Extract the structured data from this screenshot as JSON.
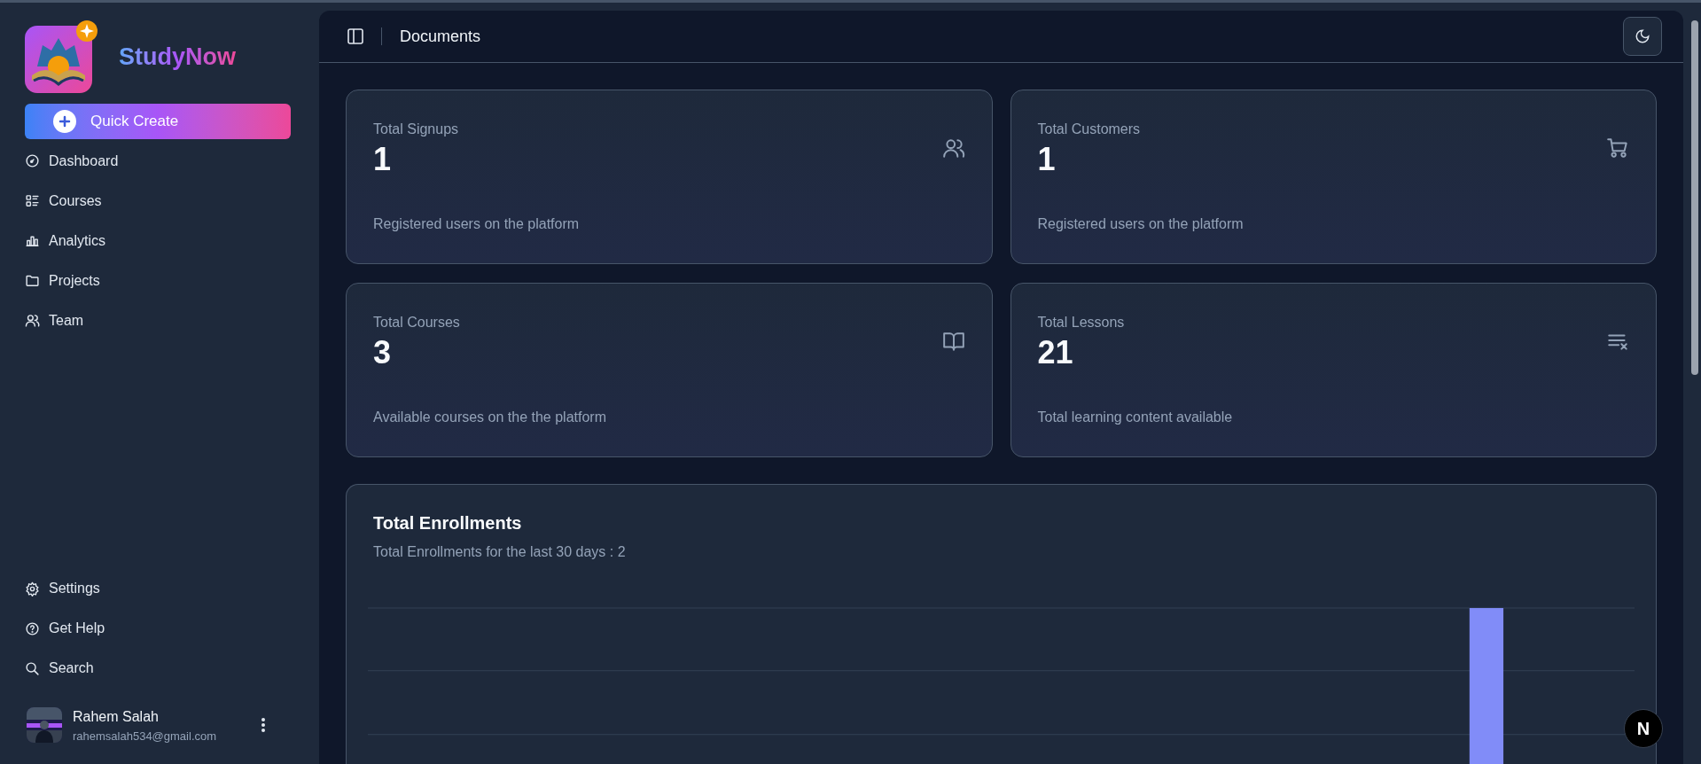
{
  "sidebar": {
    "brand": "StudyNow",
    "quick_create": "Quick Create",
    "nav_items": [
      {
        "label": "Dashboard"
      },
      {
        "label": "Courses"
      },
      {
        "label": "Analytics"
      },
      {
        "label": "Projects"
      },
      {
        "label": "Team"
      }
    ],
    "secondary_items": [
      {
        "label": "Settings"
      },
      {
        "label": "Get Help"
      },
      {
        "label": "Search"
      }
    ],
    "user": {
      "name": "Rahem Salah",
      "email": "rahemsalah534@gmail.com"
    }
  },
  "header": {
    "title": "Documents"
  },
  "stat_cards": [
    {
      "title": "Total Signups",
      "value": "1",
      "description": "Registered users on the platform"
    },
    {
      "title": "Total Customers",
      "value": "1",
      "description": "Registered users on the platform"
    },
    {
      "title": "Total Courses",
      "value": "3",
      "description": "Available courses on the the platform"
    },
    {
      "title": "Total Lessons",
      "value": "21",
      "description": "Total learning content available"
    }
  ],
  "enrollments": {
    "title": "Total Enrollments",
    "subtitle": "Total Enrollments for the last 30 days : 2"
  },
  "dev_badge": "N"
}
